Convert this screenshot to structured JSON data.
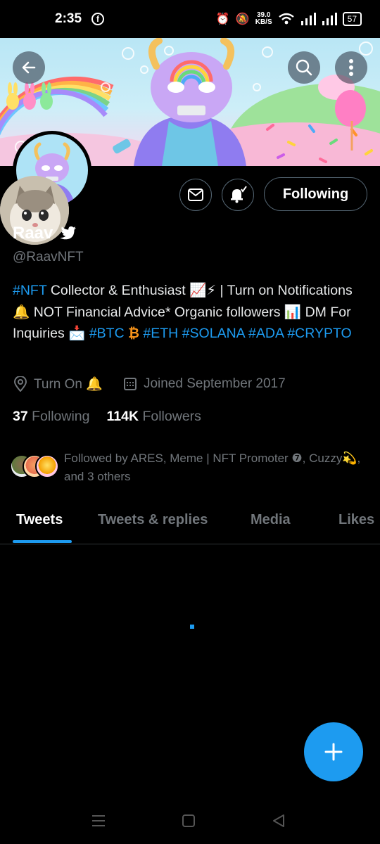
{
  "status_bar": {
    "time": "2:35",
    "fb_badge": "f",
    "net_speed_value": "39.0",
    "net_speed_unit": "KB/S",
    "battery": "57"
  },
  "profile": {
    "name": "Raav",
    "handle": "@RaavNFT",
    "follow_label": "Following",
    "bio": {
      "segments": [
        {
          "t": "#NFT",
          "c": "tag"
        },
        {
          "t": " Collector & Enthusiast 📈⚡ | Turn on Notifications 🔔 NOT Financial Advice* Organic followers 📊 DM For Inquiries 📩 ",
          "c": ""
        },
        {
          "t": "#BTC",
          "c": "tag"
        },
        {
          "t": " ₿ ",
          "c": "orange"
        },
        {
          "t": " ",
          "c": ""
        },
        {
          "t": "#ETH",
          "c": "tag"
        },
        {
          "t": " ",
          "c": ""
        },
        {
          "t": "#SOLANA",
          "c": "tag"
        },
        {
          "t": " ",
          "c": ""
        },
        {
          "t": "#ADA",
          "c": "tag"
        },
        {
          "t": " ",
          "c": ""
        },
        {
          "t": "#CRYPTO",
          "c": "tag"
        }
      ]
    },
    "location": "Turn On 🔔",
    "joined": "Joined September 2017",
    "following_count": "37",
    "following_label": "Following",
    "followers_count": "114K",
    "followers_label": "Followers",
    "followed_by": "Followed by ARES, Meme | NFT Promoter ❼, Cuzzy💫, and 3 others"
  },
  "tabs": [
    {
      "label": "Tweets"
    },
    {
      "label": "Tweets & replies"
    },
    {
      "label": "Media"
    },
    {
      "label": "Likes"
    }
  ],
  "colors": {
    "accent": "#1d9bf0",
    "background": "#000000",
    "muted": "#71767b"
  },
  "icons": [
    "back-arrow-icon",
    "search-icon",
    "more-icon",
    "mail-icon",
    "bell-notify-icon",
    "twitter-bird-icon",
    "location-icon",
    "calendar-icon",
    "compose-plus-icon"
  ]
}
